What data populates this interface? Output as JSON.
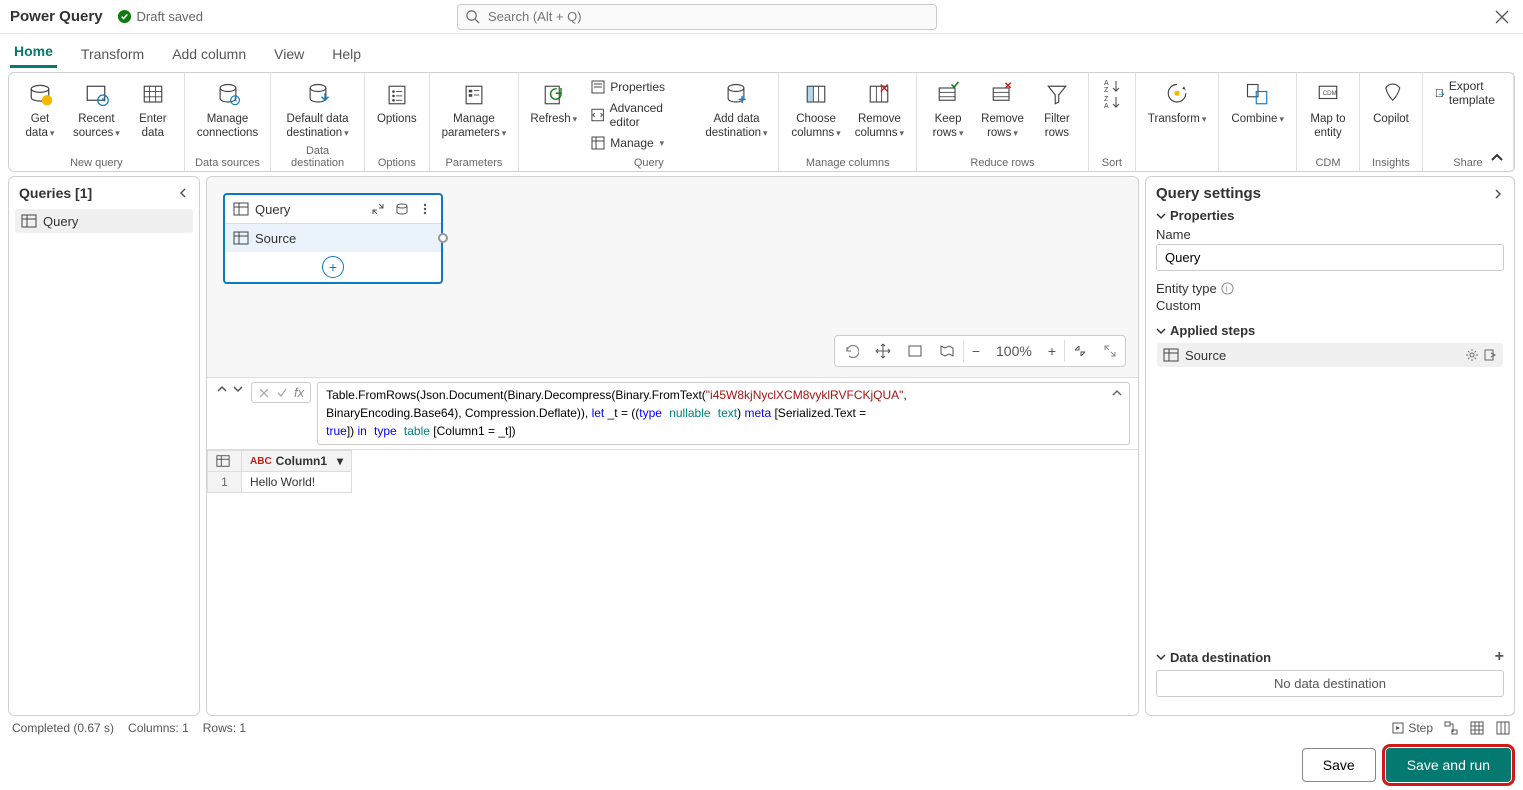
{
  "app": {
    "title": "Power Query",
    "draft_status": "Draft saved",
    "search_placeholder": "Search (Alt + Q)"
  },
  "tabs": [
    "Home",
    "Transform",
    "Add column",
    "View",
    "Help"
  ],
  "active_tab": 0,
  "ribbon": {
    "groups": [
      {
        "label": "New query",
        "buttons": [
          {
            "l": "Get\ndata",
            "d": true
          },
          {
            "l": "Recent\nsources",
            "d": true
          },
          {
            "l": "Enter\ndata"
          }
        ]
      },
      {
        "label": "Data sources",
        "buttons": [
          {
            "l": "Manage\nconnections"
          }
        ]
      },
      {
        "label": "Data destination",
        "buttons": [
          {
            "l": "Default data\ndestination",
            "d": true
          }
        ]
      },
      {
        "label": "Options",
        "buttons": [
          {
            "l": "Options"
          }
        ]
      },
      {
        "label": "Parameters",
        "buttons": [
          {
            "l": "Manage\nparameters",
            "d": true
          }
        ]
      },
      {
        "label": "Query",
        "buttons": [
          {
            "l": "Refresh",
            "d": true
          }
        ],
        "side": [
          {
            "l": "Properties"
          },
          {
            "l": "Advanced editor"
          },
          {
            "l": "Manage",
            "d": true
          }
        ],
        "extra": [
          {
            "l": "Add data\ndestination",
            "d": true
          }
        ]
      },
      {
        "label": "Manage columns",
        "buttons": [
          {
            "l": "Choose\ncolumns",
            "d": true
          },
          {
            "l": "Remove\ncolumns",
            "d": true
          }
        ]
      },
      {
        "label": "Reduce rows",
        "buttons": [
          {
            "l": "Keep\nrows",
            "d": true
          },
          {
            "l": "Remove\nrows",
            "d": true
          },
          {
            "l": "Filter\nrows"
          }
        ]
      },
      {
        "label": "Sort",
        "buttons": [
          {
            "l": ""
          }
        ]
      },
      {
        "label": "",
        "buttons": [
          {
            "l": "Transform",
            "d": true
          }
        ]
      },
      {
        "label": "",
        "buttons": [
          {
            "l": "Combine",
            "d": true
          }
        ]
      },
      {
        "label": "CDM",
        "buttons": [
          {
            "l": "Map to\nentity"
          }
        ]
      },
      {
        "label": "Insights",
        "buttons": [
          {
            "l": "Copilot"
          }
        ]
      },
      {
        "label": "Share",
        "buttons": [],
        "side": [
          {
            "l": "Export template"
          }
        ]
      }
    ]
  },
  "queries": {
    "header": "Queries [1]",
    "items": [
      {
        "name": "Query"
      }
    ]
  },
  "diagram": {
    "card_title": "Query",
    "step": "Source"
  },
  "zoom": {
    "level": "100%"
  },
  "formula_plain": "Table.FromRows(Json.Document(Binary.Decompress(Binary.FromText(\"i45W8kjNyclXCM8vyklRVFCKjQUA\", BinaryEncoding.Base64), Compression.Deflate)), let _t = ((type nullable text) meta [Serialized.Text = true]) in type table [Column1 = _t])",
  "table": {
    "columns": [
      "Column1"
    ],
    "rows": [
      [
        "Hello World!"
      ]
    ]
  },
  "settings": {
    "title": "Query settings",
    "properties_label": "Properties",
    "name_label": "Name",
    "name_value": "Query",
    "entity_label": "Entity type",
    "entity_value": "Custom",
    "applied_label": "Applied steps",
    "steps": [
      "Source"
    ],
    "destination_label": "Data destination",
    "no_destination": "No data destination"
  },
  "status": {
    "completed": "Completed (0.67 s)",
    "columns": "Columns: 1",
    "rows": "Rows: 1",
    "step_label": "Step"
  },
  "footer": {
    "save": "Save",
    "save_run": "Save and run"
  }
}
